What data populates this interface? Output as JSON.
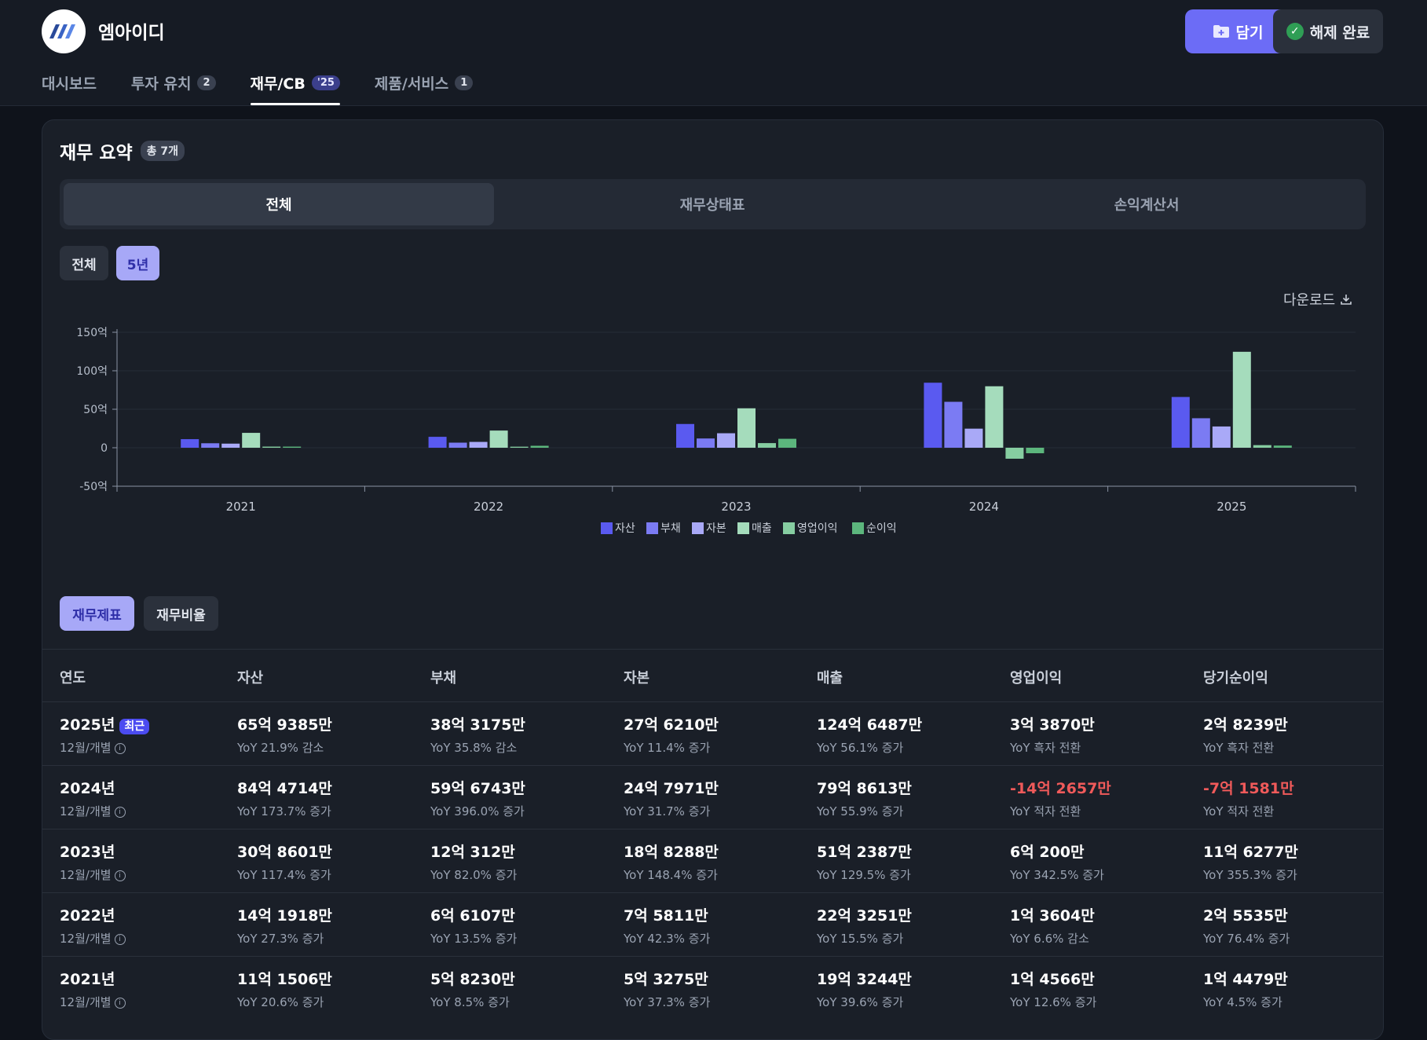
{
  "header": {
    "company_name": "엠아이디",
    "save_label": "담기",
    "release_label": "해제 완료"
  },
  "tabs": [
    {
      "label": "대시보드",
      "badge": ""
    },
    {
      "label": "투자 유치",
      "badge": "2"
    },
    {
      "label": "재무/CB",
      "badge": "'25"
    },
    {
      "label": "제품/서비스",
      "badge": "1"
    }
  ],
  "summary": {
    "title": "재무 요약",
    "count_badge": "총 7개",
    "segments": [
      "전체",
      "재무상태표",
      "손익계산서"
    ],
    "period_chips": [
      "전체",
      "5년"
    ],
    "download_label": "다운로드"
  },
  "chart_data": {
    "type": "bar",
    "categories": [
      "2021",
      "2022",
      "2023",
      "2024",
      "2025"
    ],
    "series": [
      {
        "name": "자산",
        "color": "#5a5af0",
        "values": [
          11.15,
          14.19,
          30.86,
          84.47,
          65.94
        ]
      },
      {
        "name": "부채",
        "color": "#7b7bf3",
        "values": [
          5.82,
          6.61,
          12.03,
          59.67,
          38.32
        ]
      },
      {
        "name": "자본",
        "color": "#a9a9f7",
        "values": [
          5.33,
          7.58,
          18.83,
          24.8,
          27.62
        ]
      },
      {
        "name": "매출",
        "color": "#a5dcbc",
        "values": [
          19.32,
          22.33,
          51.24,
          79.86,
          124.65
        ]
      },
      {
        "name": "영업이익",
        "color": "#86cda1",
        "values": [
          1.46,
          1.36,
          6.02,
          -14.27,
          3.39
        ]
      },
      {
        "name": "순이익",
        "color": "#5cb67d",
        "values": [
          1.45,
          2.55,
          11.63,
          -7.16,
          2.82
        ]
      }
    ],
    "y_ticks": [
      "150억",
      "100억",
      "50억",
      "0",
      "-50억"
    ],
    "ylim": [
      -50,
      150
    ]
  },
  "subtabs": [
    "재무제표",
    "재무비율"
  ],
  "table": {
    "headers": [
      "연도",
      "자산",
      "부채",
      "자본",
      "매출",
      "영업이익",
      "당기순이익"
    ],
    "latest_badge": "최근",
    "rows": [
      {
        "year": "2025년",
        "period": "12월/개별",
        "latest": true,
        "cells": [
          {
            "v": "65억 9385만",
            "s": "YoY 21.9% 감소"
          },
          {
            "v": "38억 3175만",
            "s": "YoY 35.8% 감소"
          },
          {
            "v": "27억 6210만",
            "s": "YoY 11.4% 증가"
          },
          {
            "v": "124억 6487만",
            "s": "YoY 56.1% 증가"
          },
          {
            "v": "3억 3870만",
            "s": "YoY 흑자 전환"
          },
          {
            "v": "2억 8239만",
            "s": "YoY 흑자 전환"
          }
        ]
      },
      {
        "year": "2024년",
        "period": "12월/개별",
        "latest": false,
        "cells": [
          {
            "v": "84억 4714만",
            "s": "YoY 173.7% 증가"
          },
          {
            "v": "59억 6743만",
            "s": "YoY 396.0% 증가"
          },
          {
            "v": "24억 7971만",
            "s": "YoY 31.7% 증가"
          },
          {
            "v": "79억 8613만",
            "s": "YoY 55.9% 증가"
          },
          {
            "v": "-14억 2657만",
            "s": "YoY 적자 전환",
            "neg": true
          },
          {
            "v": "-7억 1581만",
            "s": "YoY 적자 전환",
            "neg": true
          }
        ]
      },
      {
        "year": "2023년",
        "period": "12월/개별",
        "latest": false,
        "cells": [
          {
            "v": "30억 8601만",
            "s": "YoY 117.4% 증가"
          },
          {
            "v": "12억 312만",
            "s": "YoY 82.0% 증가"
          },
          {
            "v": "18억 8288만",
            "s": "YoY 148.4% 증가"
          },
          {
            "v": "51억 2387만",
            "s": "YoY 129.5% 증가"
          },
          {
            "v": "6억 200만",
            "s": "YoY 342.5% 증가"
          },
          {
            "v": "11억 6277만",
            "s": "YoY 355.3% 증가"
          }
        ]
      },
      {
        "year": "2022년",
        "period": "12월/개별",
        "latest": false,
        "cells": [
          {
            "v": "14억 1918만",
            "s": "YoY 27.3% 증가"
          },
          {
            "v": "6억 6107만",
            "s": "YoY 13.5% 증가"
          },
          {
            "v": "7억 5811만",
            "s": "YoY 42.3% 증가"
          },
          {
            "v": "22억 3251만",
            "s": "YoY 15.5% 증가"
          },
          {
            "v": "1억 3604만",
            "s": "YoY 6.6% 감소"
          },
          {
            "v": "2억 5535만",
            "s": "YoY 76.4% 증가"
          }
        ]
      },
      {
        "year": "2021년",
        "period": "12월/개별",
        "latest": false,
        "cells": [
          {
            "v": "11억 1506만",
            "s": "YoY 20.6% 증가"
          },
          {
            "v": "5억 8230만",
            "s": "YoY 8.5% 증가"
          },
          {
            "v": "5억 3275만",
            "s": "YoY 37.3% 증가"
          },
          {
            "v": "19억 3244만",
            "s": "YoY 39.6% 증가"
          },
          {
            "v": "1억 4566만",
            "s": "YoY 12.6% 증가"
          },
          {
            "v": "1억 4479만",
            "s": "YoY 4.5% 증가"
          }
        ]
      }
    ]
  }
}
